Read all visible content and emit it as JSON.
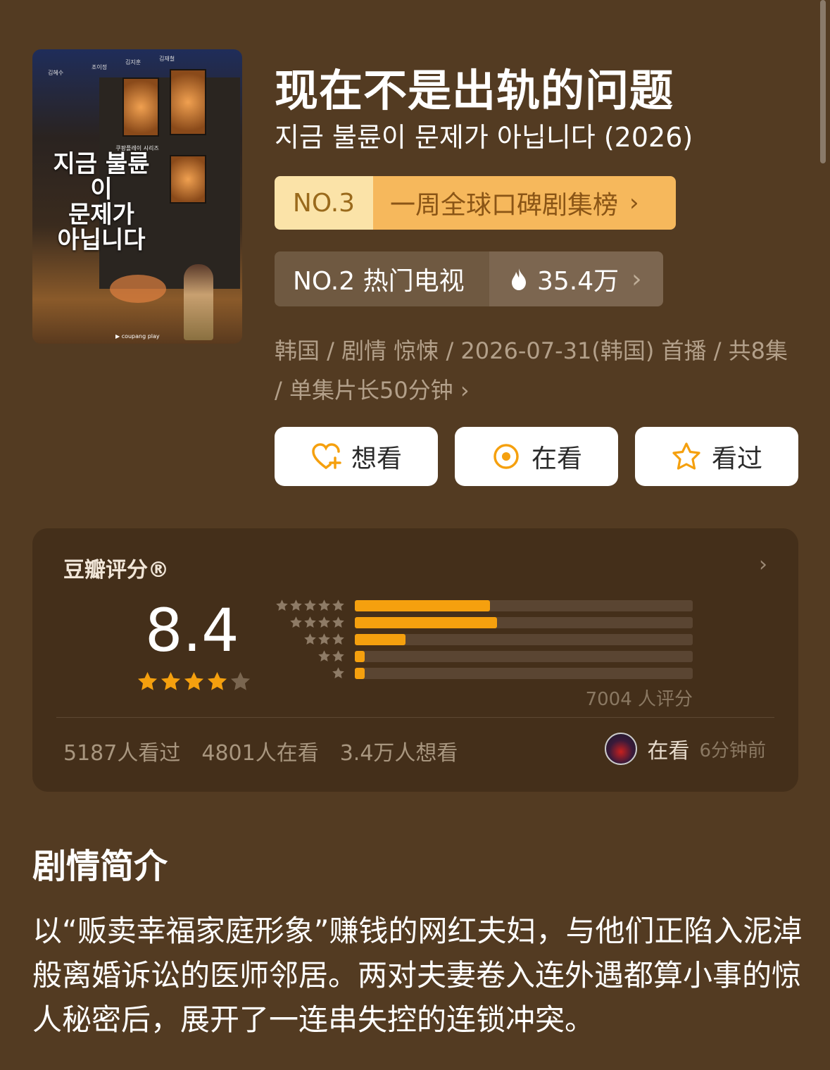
{
  "poster": {
    "cast": [
      "김혜수",
      "조이정",
      "김지훈",
      "김재철"
    ],
    "series_label": "쿠팡플레이 시리즈",
    "title_lines": "지금 불륜이\n문제가\n아닙니다",
    "brand": "▶ coupang play"
  },
  "title": "现在不是出轨的问题",
  "subtitle": "지금 불륜이 문제가 아닙니다 (2026)",
  "rank_weekly": {
    "no": "NO.3",
    "label": "一周全球口碑剧集榜",
    "chevron": "›"
  },
  "rank_hot": {
    "no": "NO.2 热门电视",
    "heat": "35.4万",
    "chevron": "›",
    "icon": "flame-icon"
  },
  "meta": "韩国 / 剧情 惊悚 / 2026-07-31(韩国) 首播 / 共8集 / 单集片长50分钟 ›",
  "actions": {
    "want": {
      "label": "想看",
      "icon": "heart-plus-icon"
    },
    "watching": {
      "label": "在看",
      "icon": "target-icon"
    },
    "watched": {
      "label": "看过",
      "icon": "star-outline-icon"
    }
  },
  "rating": {
    "label": "豆瓣评分®",
    "chevron": "›",
    "score": "8.4",
    "stars": 4,
    "votes": "7004 人评分",
    "distribution": [
      {
        "stars": 5,
        "fraction": 0.4
      },
      {
        "stars": 4,
        "fraction": 0.42
      },
      {
        "stars": 3,
        "fraction": 0.15
      },
      {
        "stars": 2,
        "fraction": 0.03
      },
      {
        "stars": 1,
        "fraction": 0.03
      }
    ],
    "stats": {
      "watched": "5187人看过",
      "watching": "4801人在看",
      "want": "3.4万人想看"
    },
    "friend": {
      "status": "在看",
      "time": "6分钟前"
    }
  },
  "synopsis": {
    "heading": "剧情简介",
    "body": "以“贩卖幸福家庭形象”赚钱的网红夫妇，与他们正陷入泥淖般离婚诉讼的医师邻居。两对夫妻卷入连外遇都算小事的惊人秘密后，展开了一连串失控的连锁冲突。"
  },
  "colors": {
    "background": "#533b22",
    "accent": "#f5a00e",
    "rank_gold": "#f6b85c"
  }
}
